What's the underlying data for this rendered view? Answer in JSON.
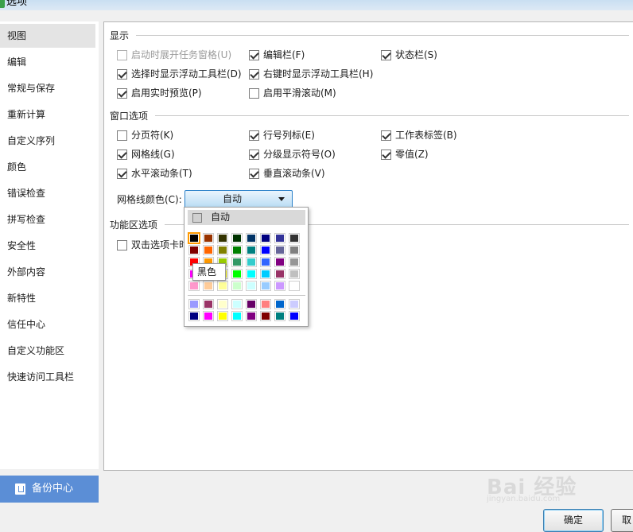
{
  "window": {
    "title": "选项"
  },
  "sidebar": {
    "items": [
      {
        "label": "视图",
        "active": true
      },
      {
        "label": "编辑"
      },
      {
        "label": "常规与保存"
      },
      {
        "label": "重新计算"
      },
      {
        "label": "自定义序列"
      },
      {
        "label": "颜色"
      },
      {
        "label": "错误检查"
      },
      {
        "label": "拼写检查"
      },
      {
        "label": "安全性"
      },
      {
        "label": "外部内容"
      },
      {
        "label": "新特性"
      },
      {
        "label": "信任中心"
      },
      {
        "label": "自定义功能区"
      },
      {
        "label": "快速访问工具栏"
      }
    ],
    "backup_label": "备份中心"
  },
  "display": {
    "title": "显示",
    "options": [
      {
        "label": "启动时展开任务窗格(U)",
        "checked": false,
        "disabled": true
      },
      {
        "label": "编辑栏(F)",
        "checked": true
      },
      {
        "label": "状态栏(S)",
        "checked": true
      },
      {
        "label": "选择时显示浮动工具栏(D)",
        "checked": true
      },
      {
        "label": "右键时显示浮动工具栏(H)",
        "checked": true
      },
      {
        "label": "启用实时预览(P)",
        "checked": true
      },
      {
        "label": "启用平滑滚动(M)",
        "checked": false
      }
    ]
  },
  "window_options": {
    "title": "窗口选项",
    "options": [
      {
        "label": "分页符(K)",
        "checked": false
      },
      {
        "label": "行号列标(E)",
        "checked": true
      },
      {
        "label": "工作表标签(B)",
        "checked": true
      },
      {
        "label": "网格线(G)",
        "checked": true
      },
      {
        "label": "分级显示符号(O)",
        "checked": true
      },
      {
        "label": "零值(Z)",
        "checked": true
      },
      {
        "label": "水平滚动条(T)",
        "checked": true
      },
      {
        "label": "垂直滚动条(V)",
        "checked": true
      }
    ],
    "gridline_color_label": "网格线颜色(C):",
    "gridline_color_value": "自动"
  },
  "ribbon_options": {
    "title": "功能区选项",
    "options": [
      {
        "label": "双击选项卡时",
        "checked": false
      }
    ]
  },
  "color_palette": {
    "auto_label": "自动",
    "tooltip": "黑色",
    "standard_rows": [
      [
        "#000000",
        "#993300",
        "#333300",
        "#003300",
        "#003366",
        "#000080",
        "#333399",
        "#333333"
      ],
      [
        "#800000",
        "#ff6600",
        "#808000",
        "#008000",
        "#008080",
        "#0000ff",
        "#666699",
        "#808080"
      ],
      [
        "#ff0000",
        "#ff9900",
        "#99cc00",
        "#339966",
        "#33cccc",
        "#3366ff",
        "#800080",
        "#969696"
      ],
      [
        "#ff00ff",
        "#ffcc00",
        "#ffff00",
        "#00ff00",
        "#00ffff",
        "#00ccff",
        "#993366",
        "#c0c0c0"
      ],
      [
        "#ff99cc",
        "#ffcc99",
        "#ffff99",
        "#ccffcc",
        "#ccffff",
        "#99ccff",
        "#cc99ff",
        "#ffffff"
      ]
    ],
    "extra_rows": [
      [
        "#9999ff",
        "#993366",
        "#ffffcc",
        "#ccffff",
        "#660066",
        "#ff8080",
        "#0066cc",
        "#ccccff"
      ],
      [
        "#000080",
        "#ff00ff",
        "#ffff00",
        "#00ffff",
        "#800080",
        "#800000",
        "#008080",
        "#0000ff"
      ]
    ],
    "selected": "#000000"
  },
  "buttons": {
    "ok": "确定",
    "cancel": "取"
  },
  "watermark": {
    "main": "Bai 经验",
    "sub": "jingyan.baidu.com"
  }
}
